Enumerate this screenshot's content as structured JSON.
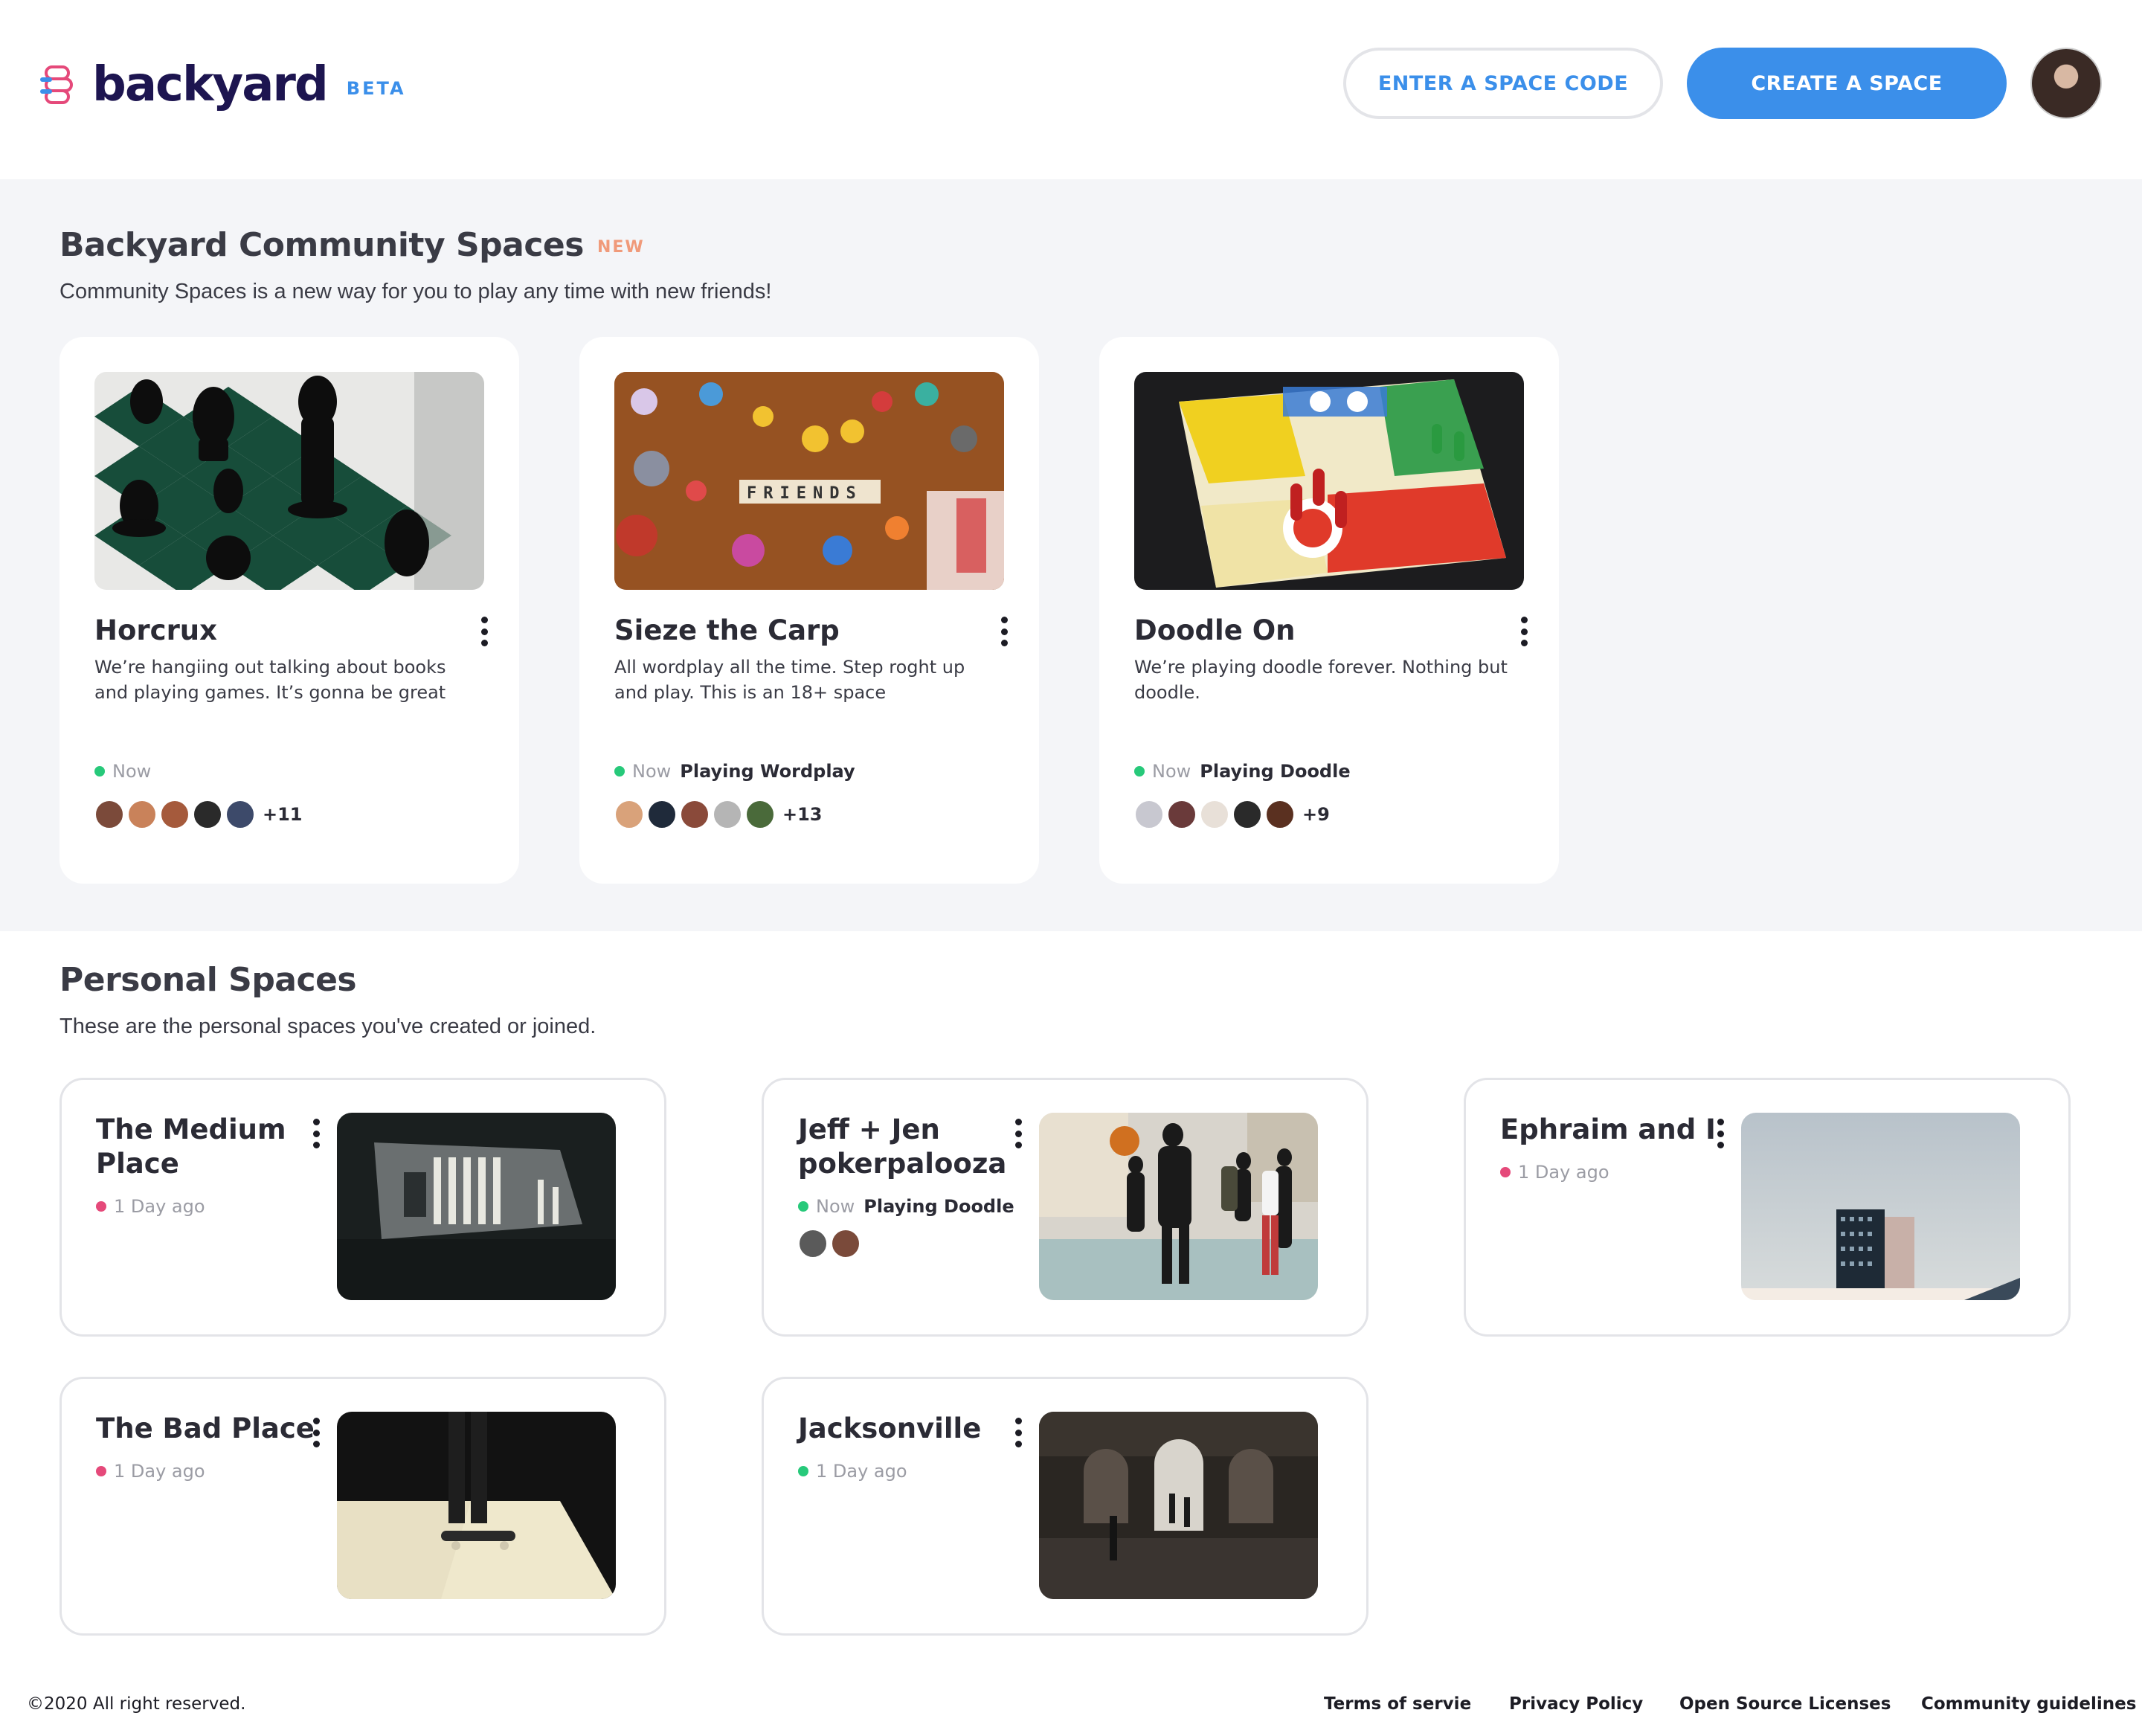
{
  "colors": {
    "accent": "#3b8fea",
    "brand": "#1d1550",
    "new_badge": "#f09a7a",
    "status_green": "#27c97a",
    "status_pink": "#e5497a",
    "section_bg": "#f4f5f8"
  },
  "header": {
    "logo_icon": "backyard-logo-icon",
    "logo_text": "backyard",
    "beta_label": "BETA",
    "enter_code_label": "ENTER A SPACE CODE",
    "create_label": "CREATE A SPACE",
    "avatar_icon": "user-avatar"
  },
  "community": {
    "title": "Backyard Community Spaces",
    "new_badge": "NEW",
    "subtitle": "Community Spaces is a new way for you to play any time with new friends!",
    "cards": [
      {
        "title": "Horcrux",
        "image": "chess-pieces-photo",
        "description": "We’re hangiing out talking about books and playing games. It’s gonna be great",
        "when": "Now",
        "playing": "",
        "extra_count": "+11"
      },
      {
        "title": "Sieze the Carp",
        "image": "toys-friends-photo",
        "description": "All wordplay all the time. Step roght up and play. This is an 18+ space",
        "when": "Now",
        "playing": "Playing Wordplay",
        "extra_count": "+13"
      },
      {
        "title": "Doodle On",
        "image": "ludo-board-photo",
        "description": "We’re playing doodle forever. Nothing but doodle.",
        "when": "Now",
        "playing": "Playing Doodle",
        "extra_count": "+9"
      }
    ]
  },
  "personal": {
    "title": "Personal Spaces",
    "subtitle": "These are the personal spaces you've created or joined.",
    "cards": [
      {
        "title": "The Medium Place",
        "image": "car-window-building-photo",
        "when": "1 Day ago",
        "playing": "",
        "status": "pink"
      },
      {
        "title": "Jeff + Jen pokerpalooza",
        "image": "basketball-players-photo",
        "when": "Now",
        "playing": "Playing Doodle",
        "status": "green"
      },
      {
        "title": "Ephraim and I",
        "image": "tall-building-photo",
        "when": "1 Day ago",
        "playing": "",
        "status": "pink"
      },
      {
        "title": "The Bad Place",
        "image": "skateboard-photo",
        "when": "1 Day ago",
        "playing": "",
        "status": "pink"
      },
      {
        "title": "Jacksonville",
        "image": "train-station-photo",
        "when": "1 Day ago",
        "playing": "",
        "status": "green"
      }
    ]
  },
  "footer": {
    "copyright": "©2020 All right reserved.",
    "terms": "Terms of servie",
    "privacy": "Privacy Policy",
    "licenses": "Open Source Licenses",
    "guidelines": "Community guidelines"
  }
}
